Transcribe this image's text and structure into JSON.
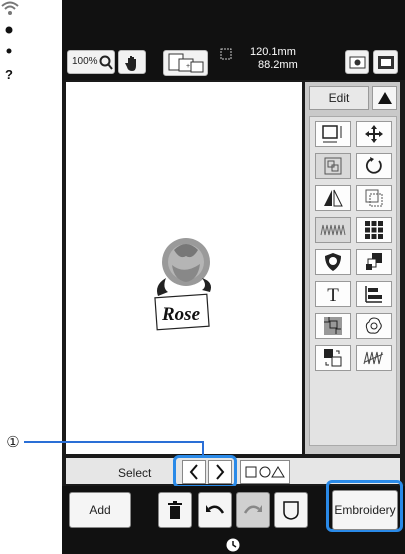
{
  "toolbar": {
    "zoom_label": "100%",
    "size_width": "120.1mm",
    "size_height": "88.2mm"
  },
  "panel": {
    "edit_label": "Edit"
  },
  "design": {
    "text": "Rose"
  },
  "select_bar": {
    "label": "Select"
  },
  "bottom": {
    "add_label": "Add",
    "embroidery_label": "Embroidery"
  },
  "callout": {
    "number": "①"
  },
  "colors": {
    "accent": "#2a8ae8",
    "background": "#111111"
  },
  "icons": [
    "wifi-icon",
    "camera-icon",
    "gear-icon",
    "help-icon",
    "presser-icon",
    "lock-icon",
    "home-icon",
    "zoom-icon",
    "hand-icon",
    "layout-icon",
    "scan-icon",
    "image-icon",
    "triangle-icon",
    "resize-icon",
    "move-icon",
    "group-icon",
    "rotate-icon",
    "mirror-icon",
    "border-icon",
    "stitch-icon",
    "array-icon",
    "applique-icon",
    "color-sort-icon",
    "text-icon",
    "align-icon",
    "fill-icon",
    "outline-icon",
    "order-icon",
    "stipple-icon",
    "prev-icon",
    "next-icon",
    "shape-select-icon",
    "trash-icon",
    "undo-icon",
    "redo-icon",
    "frame-icon",
    "clock-icon"
  ]
}
